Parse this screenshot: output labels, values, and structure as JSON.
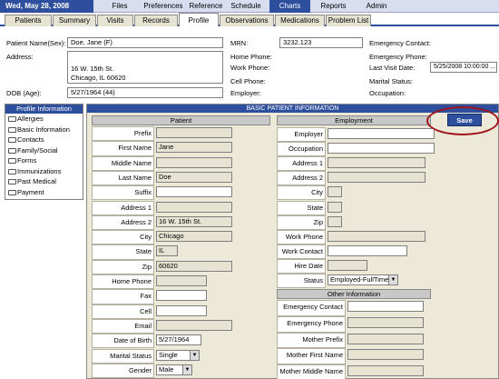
{
  "topbar": {
    "date": "Wed, May 28, 2008",
    "menus": [
      "Files",
      "Preferences",
      "Reference",
      "Schedule",
      "Charts",
      "Reports",
      "Admin"
    ]
  },
  "tabs": [
    "Patients",
    "Summary",
    "Visits",
    "Records",
    "Profile",
    "Observations",
    "Medications",
    "Problem List"
  ],
  "patient": {
    "name_label": "Patient Name(Sex):",
    "name_value": "Doe, Jane (F)",
    "address_label": "Address:",
    "address_line1": "16 W. 15th St.",
    "address_line2": "Chicago, IL 60620",
    "dob_label": "DOB (Age):",
    "dob_value": "5/27/1964 (44)",
    "mrn_label": "MRN:",
    "mrn_value": "3232.123",
    "home_phone_label": "Home Phone:",
    "work_phone_label": "Work Phone:",
    "cell_phone_label": "Cell Phone:",
    "employer_label": "Employer:",
    "emergency_contact_label": "Emergency Contact:",
    "emergency_phone_label": "Emergency Phone:",
    "last_visit_label": "Last Visit Date:",
    "last_visit_value": "5/25/2008 10:00:00 ...",
    "marital_label": "Marital Status:",
    "occupation_label": "Occupation:"
  },
  "profile_panel": {
    "title": "Profile Information",
    "items": [
      "Allergies",
      "Basic Information",
      "Contacts",
      "Family/Social",
      "Forms",
      "Immunizations",
      "Past Medical",
      "Payment"
    ]
  },
  "form": {
    "title": "BASIC PATIENT INFORMATION",
    "save_label": "Save",
    "patient_section": "Patient",
    "employment_section": "Employment",
    "other_section": "Other Information",
    "patient_fields": [
      {
        "label": "Prefix",
        "value": ""
      },
      {
        "label": "First Name",
        "value": "Jane"
      },
      {
        "label": "Middle Name",
        "value": ""
      },
      {
        "label": "Last Name",
        "value": "Doe"
      },
      {
        "label": "Suffix",
        "value": ""
      },
      {
        "label": "Address 1",
        "value": ""
      },
      {
        "label": "Address 2",
        "value": "16 W. 15th St."
      },
      {
        "label": "City",
        "value": "Chicago"
      },
      {
        "label": "State",
        "value": "IL"
      },
      {
        "label": "Zip",
        "value": "60620"
      },
      {
        "label": "Home Phone",
        "value": ""
      },
      {
        "label": "Fax",
        "value": ""
      },
      {
        "label": "Cell",
        "value": ""
      },
      {
        "label": "Email",
        "value": ""
      },
      {
        "label": "Date of Birth",
        "value": "5/27/1964"
      },
      {
        "label": "Marital Status",
        "value": "Single"
      },
      {
        "label": "Gender",
        "value": "Male"
      }
    ],
    "employment_fields": [
      {
        "label": "Employer",
        "value": ""
      },
      {
        "label": "Occupation",
        "value": ""
      },
      {
        "label": "Address 1",
        "value": ""
      },
      {
        "label": "Address 2",
        "value": ""
      },
      {
        "label": "City",
        "value": ""
      },
      {
        "label": "State",
        "value": ""
      },
      {
        "label": "Zip",
        "value": ""
      },
      {
        "label": "Work Phone",
        "value": ""
      },
      {
        "label": "Work Contact",
        "value": ""
      },
      {
        "label": "Hire Date",
        "value": ""
      },
      {
        "label": "Status",
        "value": "Employed-FullTime"
      }
    ],
    "other_fields": [
      {
        "label": "Emergency Contact",
        "value": ""
      },
      {
        "label": "Emergency Phone",
        "value": ""
      },
      {
        "label": "Mother Prefix",
        "value": ""
      },
      {
        "label": "Mother First Name",
        "value": ""
      },
      {
        "label": "Mother Middle Name",
        "value": ""
      }
    ]
  }
}
